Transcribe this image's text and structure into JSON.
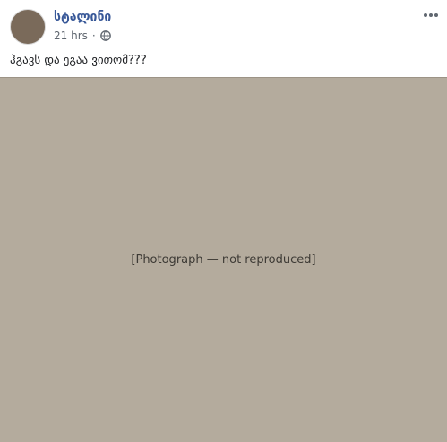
{
  "post": {
    "author_name": "სტალინი",
    "timestamp": "21 hrs",
    "separator": "·",
    "audience_icon": "globe-icon",
    "menu_icon": "more-options-icon",
    "text": "ჰგავს და ეგაა ვითომ???"
  },
  "image": {
    "placeholder_label": "[Photograph — not reproduced]"
  },
  "colors": {
    "author": "#385898",
    "meta": "#606770",
    "text": "#1c1e21",
    "image_placeholder": "#b4ab9d"
  }
}
